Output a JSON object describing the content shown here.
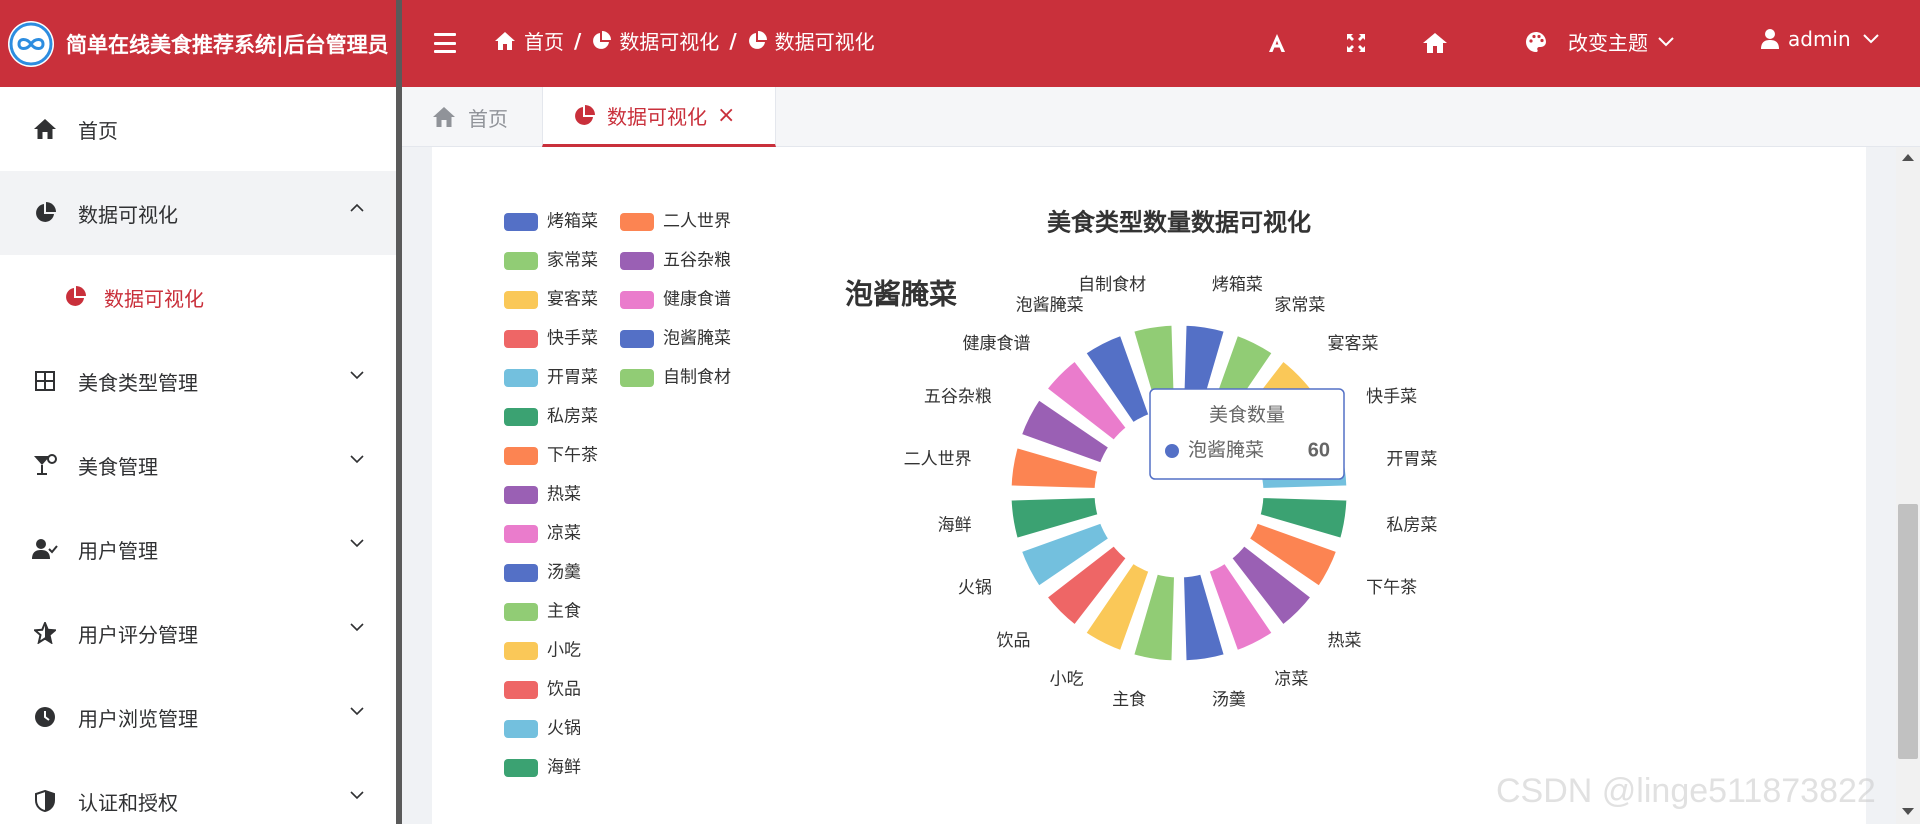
{
  "header": {
    "brand_title": "简单在线美食推荐系统|后台管理员",
    "breadcrumb": [
      "首页",
      "数据可视化",
      "数据可视化"
    ],
    "theme_label": "改变主题",
    "user_label": "admin"
  },
  "sidebar": {
    "items": [
      {
        "label": "首页",
        "icon": "home-icon"
      },
      {
        "label": "数据可视化",
        "icon": "pie-chart-icon",
        "open": true,
        "children": [
          "数据可视化"
        ]
      },
      {
        "label": "美食类型管理",
        "icon": "grid-icon"
      },
      {
        "label": "美食管理",
        "icon": "cocktail-icon"
      },
      {
        "label": "用户管理",
        "icon": "user-check-icon"
      },
      {
        "label": "用户评分管理",
        "icon": "star-icon"
      },
      {
        "label": "用户浏览管理",
        "icon": "clock-icon"
      },
      {
        "label": "认证和授权",
        "icon": "shield-icon"
      }
    ]
  },
  "tabs": [
    {
      "label": "首页",
      "icon": "home-icon"
    },
    {
      "label": "数据可视化",
      "icon": "pie-chart-icon",
      "active": true
    }
  ],
  "tooltip": {
    "title": "美食数量",
    "name": "泡酱腌菜",
    "value": "60"
  },
  "watermark": "CSDN @linge511873822",
  "colors": {
    "accent": "#c9303b",
    "palette": [
      "#5470c6",
      "#91cc75",
      "#fac858",
      "#ee6666",
      "#73c0de",
      "#3ba272",
      "#fc8452",
      "#9a60b4",
      "#ea7ccc"
    ]
  },
  "chart_data": {
    "type": "pie",
    "variant": "rose-donut",
    "title": "美食类型数量数据可视化",
    "center_label": "泡酱腌菜",
    "legend_position": "left",
    "categories": [
      "烤箱菜",
      "家常菜",
      "宴客菜",
      "快手菜",
      "开胃菜",
      "私房菜",
      "下午茶",
      "热菜",
      "凉菜",
      "汤羹",
      "主食",
      "小吃",
      "饮品",
      "火锅",
      "海鲜",
      "二人世界",
      "五谷杂粮",
      "健康食谱",
      "泡酱腌菜",
      "自制食材"
    ],
    "values": [
      60,
      60,
      60,
      60,
      60,
      60,
      60,
      60,
      60,
      60,
      60,
      60,
      60,
      60,
      60,
      60,
      60,
      60,
      60,
      60
    ]
  }
}
